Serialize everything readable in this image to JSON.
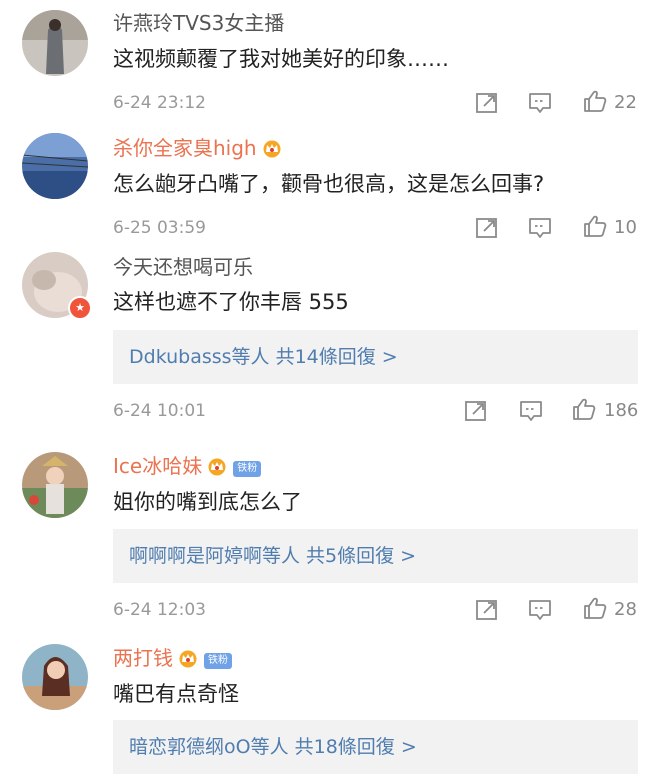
{
  "comments": [
    {
      "username": "许燕玲TVS3女主播",
      "text": "这视频颠覆了我对她美好的印象……",
      "time": "6-24 23:12",
      "likes": "22"
    },
    {
      "username": "杀你全家臭high",
      "text": "怎么龅牙凸嘴了，颧骨也很高，这是怎么回事?",
      "time": "6-25 03:59",
      "likes": "10"
    },
    {
      "username": "今天还想喝可乐",
      "text": "这样也遮不了你丰唇 555",
      "replies": "Ddkubasss等人 共14條回復 >",
      "time": "6-24 10:01",
      "likes": "186"
    },
    {
      "username": "Ice冰哈妹",
      "fan_badge": "铁粉",
      "text": "姐你的嘴到底怎么了",
      "replies": "啊啊啊是阿婷啊等人 共5條回復 >",
      "time": "6-24 12:03",
      "likes": "28"
    },
    {
      "username": "两打钱",
      "fan_badge": "铁粉",
      "text": "嘴巴有点奇怪",
      "replies": "暗恋郭德纲oO等人 共18條回復 >"
    }
  ],
  "icons": {
    "share": "share-icon",
    "comment": "comment-icon",
    "like": "thumbs-up-icon",
    "crown": "crown-icon",
    "verified": "verified-icon"
  },
  "colors": {
    "username_orange": "#eb7350",
    "reply_link": "#507daf",
    "reply_bg": "#f2f2f2",
    "meta_gray": "#999999"
  }
}
